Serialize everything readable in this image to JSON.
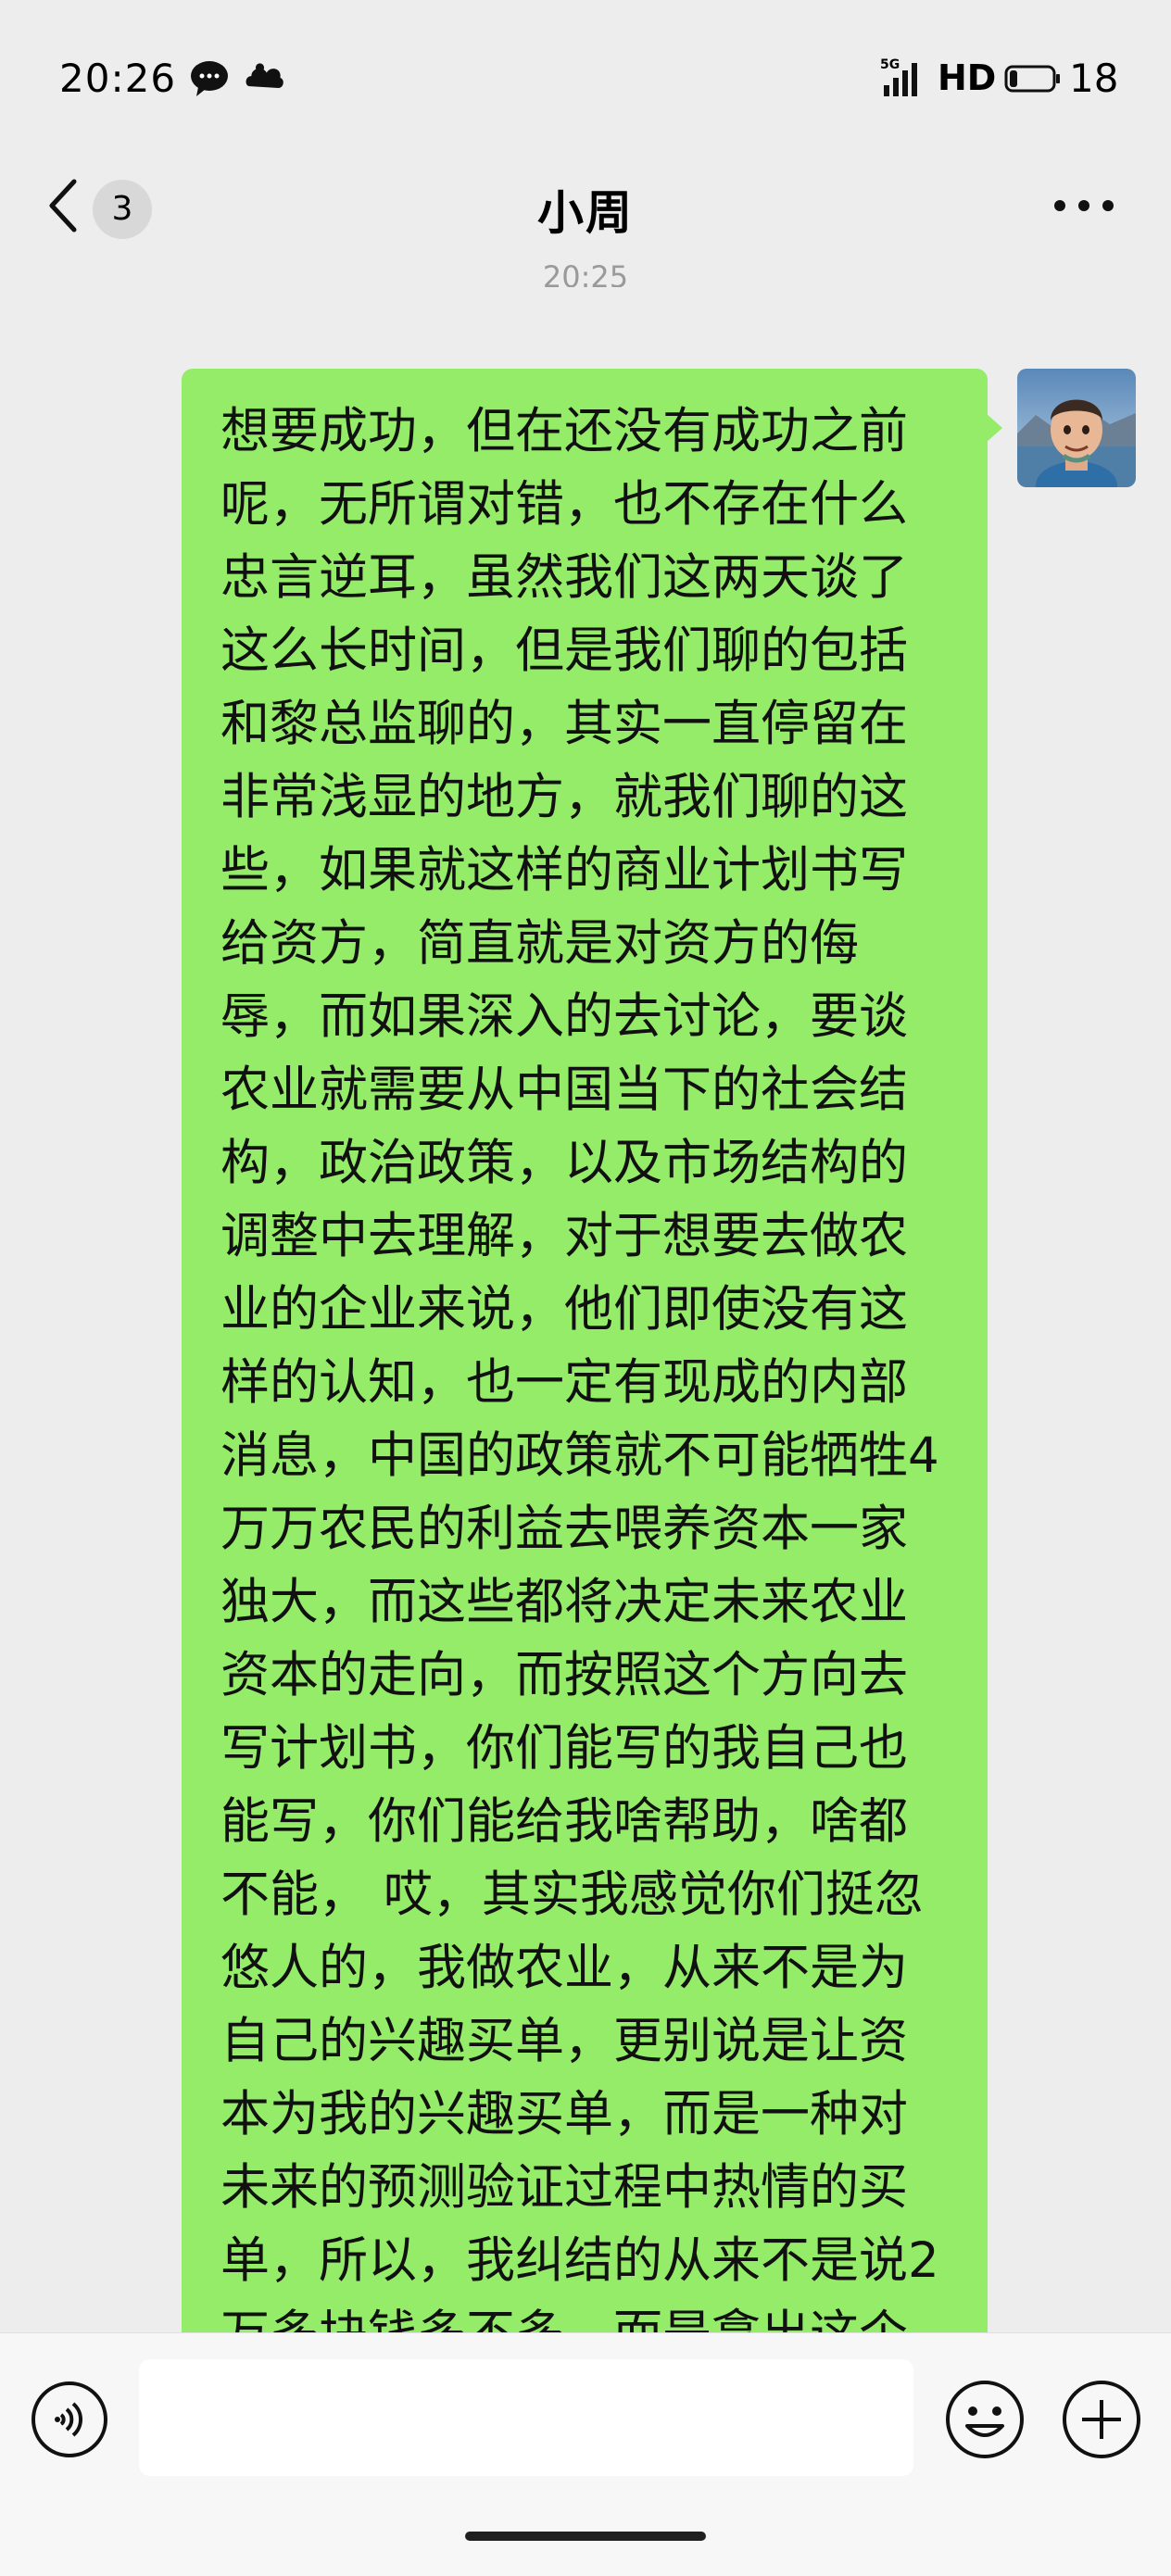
{
  "status_bar": {
    "time": "20:26",
    "network": "5G",
    "hd": "HD",
    "battery": "18"
  },
  "header": {
    "unread_count": "3",
    "title": "小周"
  },
  "messages": {
    "timestamp": "20:25",
    "outgoing_text": "想要成功，但在还没有成功之前呢，无所谓对错，也不存在什么忠言逆耳，虽然我们这两天谈了这么长时间，但是我们聊的包括和黎总监聊的，其实一直停留在非常浅显的地方，就我们聊的这些，如果就这样的商业计划书写给资方，简直就是对资方的侮辱，而如果深入的去讨论，要谈农业就需要从中国当下的社会结构，政治政策，以及市场结构的调整中去理解，对于想要去做农业的企业来说，他们即使没有这样的认知，也一定有现成的内部消息，中国的政策就不可能牺牲4万万农民的利益去喂养资本一家独大，而这些都将决定未来农业资本的走向，而按照这个方向去写计划书，你们能写的我自己也能写，你们能给我啥帮助，啥都不能，\n哎，其实我感觉你们挺忽悠人的，我做农业，从来不是为自己的兴趣买单，更别说是让资本为我的兴趣买单，而是一种对未来的预测验证过程中热情的买单，所以，我纠结的从来不是说2万多块钱多不多，而是拿出这个钱，是算到对这个项目的投资？是算到对资方能力好奇"
  },
  "input_bar": {
    "placeholder": ""
  },
  "colors": {
    "background": "#ededed",
    "bubble_outgoing": "#95ec69",
    "input_bar": "#f7f7f7"
  }
}
